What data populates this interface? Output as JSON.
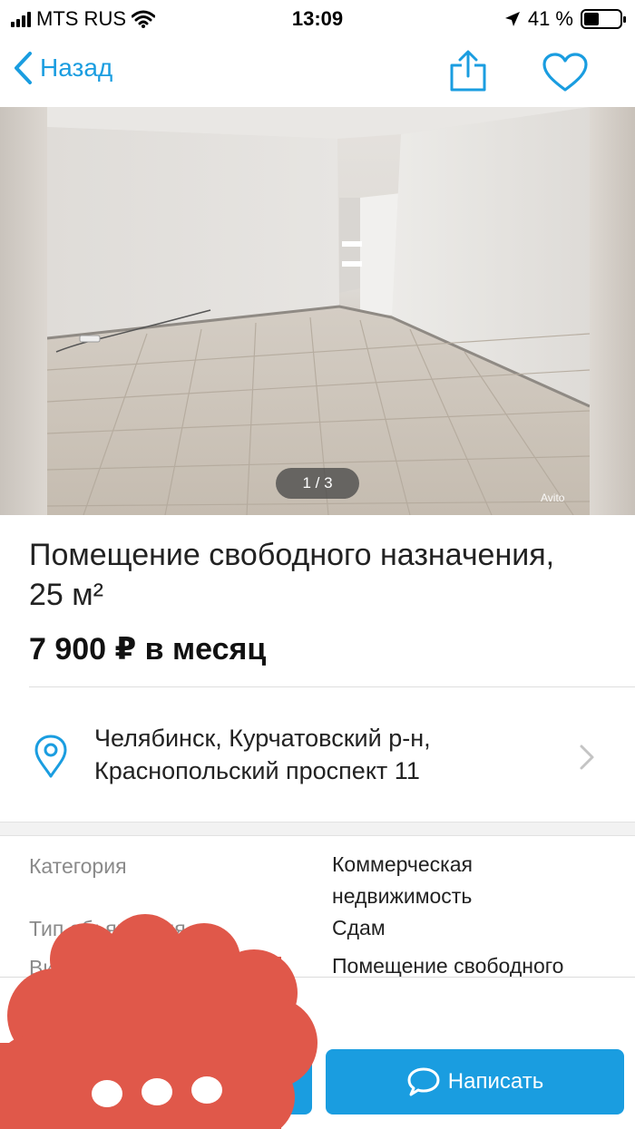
{
  "status_bar": {
    "carrier": "MTS RUS",
    "time": "13:09",
    "battery_text": "41 %",
    "battery_level": 0.41
  },
  "nav": {
    "back_label": "Назад",
    "icons": [
      "chevron-left-icon",
      "share-icon",
      "heart-icon"
    ],
    "accent_color": "#1a9de0"
  },
  "photo": {
    "counter": "1 / 3",
    "watermark": "Avito"
  },
  "listing": {
    "title": "Помещение свободного назначения, 25 м²",
    "price": "7 900 ₽ в месяц"
  },
  "location": {
    "line1": "Челябинск, Курчатовский р-н,",
    "line2": "Краснопольский проспект 11"
  },
  "params": {
    "category_label": "Категория",
    "category_value_1": "Коммерческая",
    "category_value_2": "недвижимость",
    "row2_label": "Тип объявления",
    "row2_value": "Сдам",
    "row3_label": "Вид объекта",
    "row3_value": "Помещение свободного"
  },
  "actions": {
    "write_label": "Написать",
    "button_color": "#1a9de0"
  },
  "redaction_color": "#e0584a"
}
